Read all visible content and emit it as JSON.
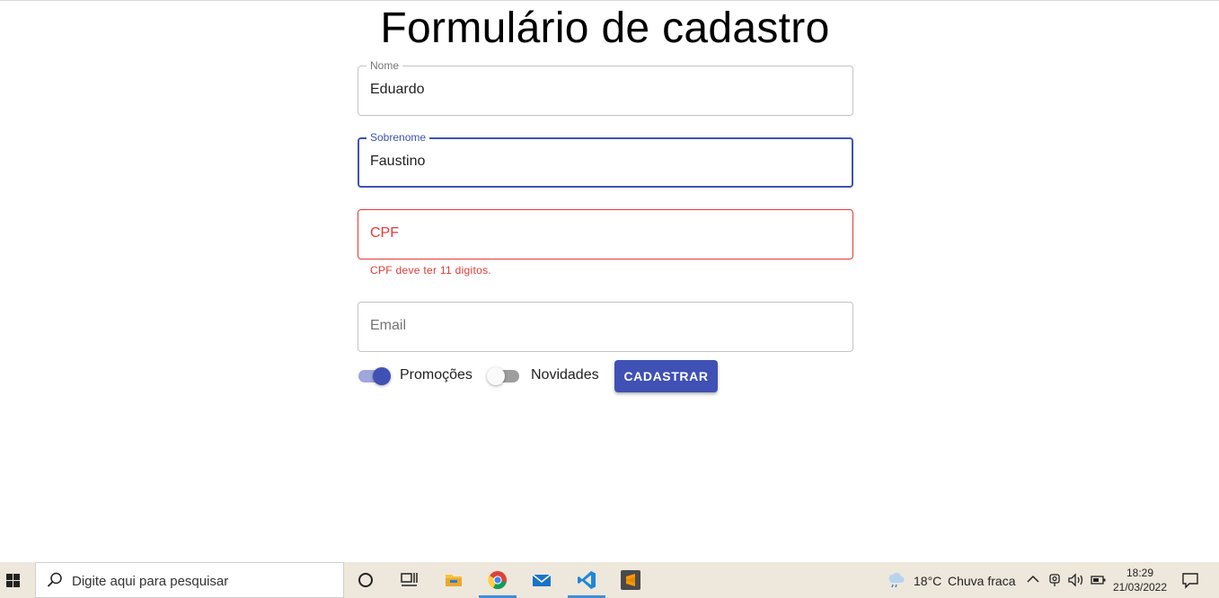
{
  "form": {
    "title": "Formulário de cadastro",
    "nome": {
      "label": "Nome",
      "value": "Eduardo"
    },
    "sobrenome": {
      "label": "Sobrenome",
      "value": "Faustino"
    },
    "cpf": {
      "label": "CPF",
      "value": "",
      "error": "CPF deve ter 11 digitos."
    },
    "email": {
      "label": "Email",
      "value": ""
    },
    "promocoes": {
      "label": "Promoções",
      "checked": true
    },
    "novidades": {
      "label": "Novidades",
      "checked": false
    },
    "submit_label": "CADASTRAR"
  },
  "colors": {
    "primary": "#3f51b5",
    "error": "#e53935"
  },
  "taskbar": {
    "search_placeholder": "Digite aqui para pesquisar",
    "apps": [
      "task-view-icon",
      "timeline-icon",
      "file-explorer-icon",
      "chrome-icon",
      "mail-icon",
      "vscode-icon",
      "sublime-text-icon"
    ],
    "weather": {
      "temp": "18°C",
      "condition": "Chuva fraca"
    },
    "time": "18:29",
    "date": "21/03/2022"
  }
}
